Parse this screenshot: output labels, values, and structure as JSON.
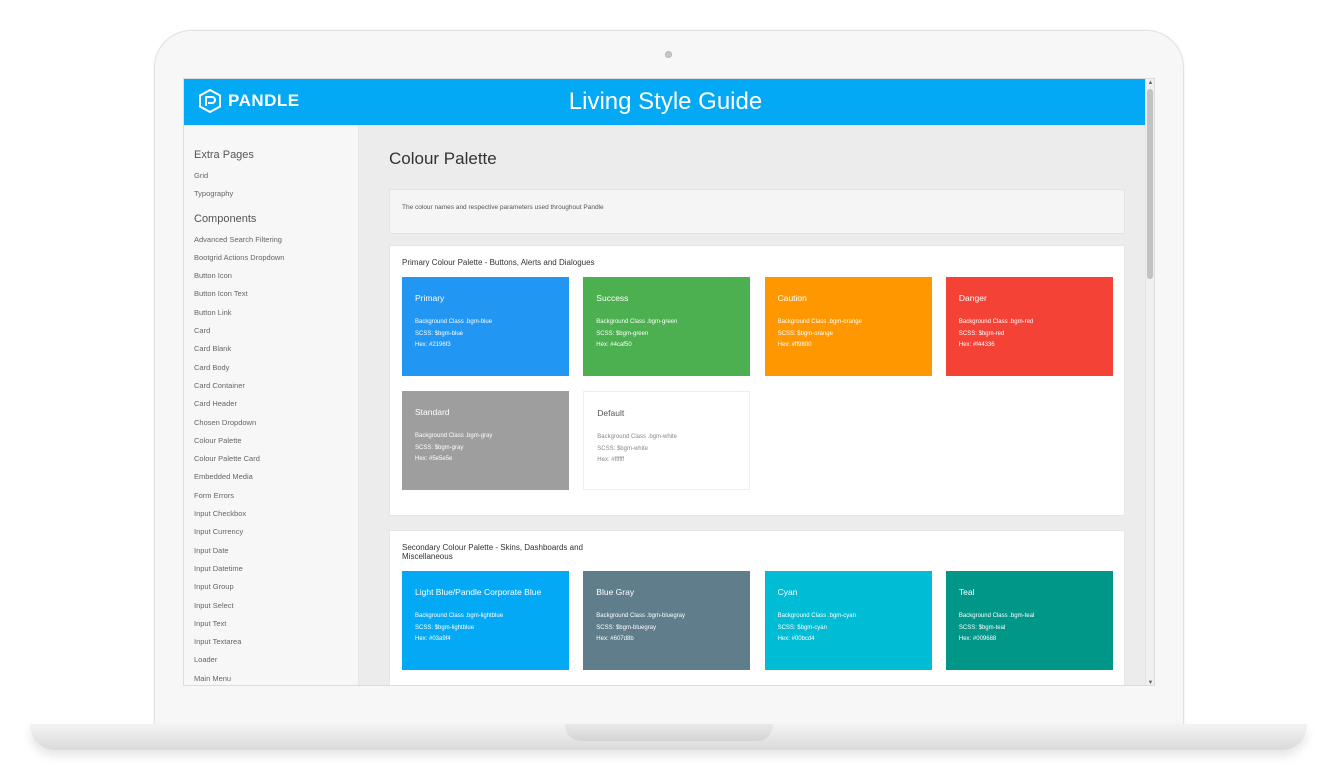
{
  "header": {
    "logo_text": "PANDLE",
    "title": "Living Style Guide"
  },
  "sidebar": {
    "extra_heading": "Extra Pages",
    "extra_items": [
      "Grid",
      "Typography"
    ],
    "components_heading": "Components",
    "component_items": [
      "Advanced Search Filtering",
      "Bootgrid Actions Dropdown",
      "Button Icon",
      "Button Icon Text",
      "Button Link",
      "Card",
      "Card Blank",
      "Card Body",
      "Card Container",
      "Card Header",
      "Chosen Dropdown",
      "Colour Palette",
      "Colour Palette Card",
      "Embedded Media",
      "Form Errors",
      "Input Checkbox",
      "Input Currency",
      "Input Date",
      "Input Datetime",
      "Input Group",
      "Input Select",
      "Input Text",
      "Input Textarea",
      "Loader",
      "Main Menu"
    ]
  },
  "main": {
    "title": "Colour Palette",
    "intro": "The colour names and respective parameters used throughout Pandle",
    "primary": {
      "title": "Primary Colour Palette - Buttons, Alerts and Dialogues",
      "swatches": [
        {
          "name": "Primary",
          "bg_class": "Background Class .bgm-blue",
          "scss": "SCSS: $bgm-blue",
          "hex": "Hex: #2196f3",
          "color": "#2196f3"
        },
        {
          "name": "Success",
          "bg_class": "Background Class .bgm-green",
          "scss": "SCSS: $bgm-green",
          "hex": "Hex: #4caf50",
          "color": "#4caf50"
        },
        {
          "name": "Caution",
          "bg_class": "Background Class .bgm-orange",
          "scss": "SCSS: $bgm-orange",
          "hex": "Hex: #ff9800",
          "color": "#ff9800"
        },
        {
          "name": "Danger",
          "bg_class": "Background Class .bgm-red",
          "scss": "SCSS: $bgm-red",
          "hex": "Hex: #f44336",
          "color": "#f44336"
        },
        {
          "name": "Standard",
          "bg_class": "Background Class .bgm-gray",
          "scss": "SCSS: $bgm-gray",
          "hex": "Hex: #5e5e5e",
          "color": "#9e9e9e"
        },
        {
          "name": "Default",
          "bg_class": "Background Class .bgm-white",
          "scss": "SCSS: $bgm-white",
          "hex": "Hex: #ffffff",
          "color": "#ffffff"
        }
      ]
    },
    "secondary": {
      "title": "Secondary Colour Palette - Skins, Dashboards and Miscellaneous",
      "swatches": [
        {
          "name": "Light Blue/Pandle Corporate Blue",
          "bg_class": "Background Class .bgm-lightblue",
          "scss": "SCSS: $bgm-lightblue",
          "hex": "Hex: #03a9f4",
          "color": "#03a9f4"
        },
        {
          "name": "Blue Gray",
          "bg_class": "Background Class .bgm-bluegray",
          "scss": "SCSS: $bgm-bluegray",
          "hex": "Hex: #607d8b",
          "color": "#607d8b"
        },
        {
          "name": "Cyan",
          "bg_class": "Background Class .bgm-cyan",
          "scss": "SCSS: $bgm-cyan",
          "hex": "Hex: #00bcd4",
          "color": "#00bcd4"
        },
        {
          "name": "Teal",
          "bg_class": "Background Class .bgm-teal",
          "scss": "SCSS: $bgm-teal",
          "hex": "Hex: #009688",
          "color": "#009688"
        }
      ],
      "next_row_colors": [
        "#4caf50",
        "#8bc34a",
        "#ff9800",
        "#2196f3"
      ]
    }
  }
}
